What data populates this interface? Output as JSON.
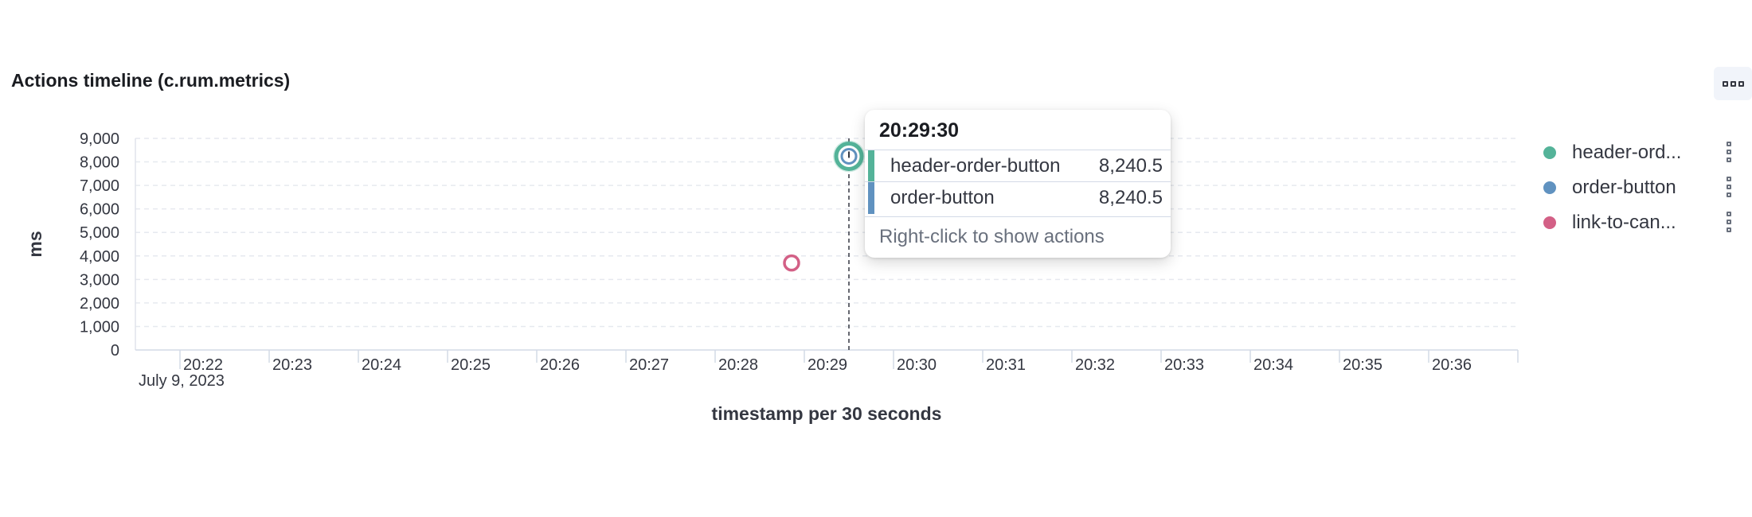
{
  "panel": {
    "title": "Actions timeline (c.rum.metrics)",
    "menu_icon": "boxes-horizontal-icon"
  },
  "chart_data": {
    "type": "scatter",
    "ylabel": "ms",
    "xlabel": "timestamp per 30 seconds",
    "ylim": [
      0,
      9000
    ],
    "y_ticks": [
      "9,000",
      "8,000",
      "7,000",
      "6,000",
      "5,000",
      "4,000",
      "3,000",
      "2,000",
      "1,000",
      "0"
    ],
    "y_tick_values": [
      9000,
      8000,
      7000,
      6000,
      5000,
      4000,
      3000,
      2000,
      1000,
      0
    ],
    "x_ticks": [
      "20:22",
      "20:23",
      "20:24",
      "20:25",
      "20:26",
      "20:27",
      "20:28",
      "20:29",
      "20:30",
      "20:31",
      "20:32",
      "20:33",
      "20:34",
      "20:35",
      "20:36"
    ],
    "x_date_label": "July 9, 2023",
    "xlim": [
      "20:21:30",
      "20:37:00"
    ],
    "grid": true,
    "legend_position": "right",
    "series": [
      {
        "name": "header-order-button",
        "legend_label": "header-ord...",
        "color": "#54b399",
        "points": [
          {
            "x": "20:29:30",
            "y": 8240.5
          }
        ]
      },
      {
        "name": "order-button",
        "legend_label": "order-button",
        "color": "#6092c0",
        "points": [
          {
            "x": "20:29:30",
            "y": 8240.5
          }
        ]
      },
      {
        "name": "link-to-can...",
        "legend_label": "link-to-can...",
        "color": "#d36086",
        "points": [
          {
            "x": "20:29:00",
            "y": 3700
          }
        ]
      }
    ],
    "crosshair_x": "20:29:30"
  },
  "tooltip": {
    "time": "20:29:30",
    "rows": [
      {
        "name": "header-order-button",
        "value": "8,240.5",
        "color": "#54b399"
      },
      {
        "name": "order-button",
        "value": "8,240.5",
        "color": "#6092c0"
      }
    ],
    "hint": "Right-click to show actions"
  },
  "legend_more_icon": "boxes-vertical-icon"
}
